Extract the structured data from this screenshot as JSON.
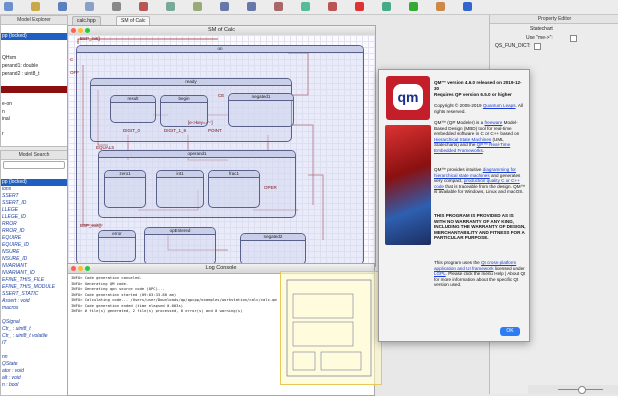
{
  "toolbar": {
    "icons": [
      "new-icon",
      "open-icon",
      "save-icon",
      "save-all-icon",
      "print-icon",
      "cut-icon",
      "copy-icon",
      "paste-icon",
      "undo-icon",
      "redo-icon",
      "find-icon",
      "zoom-in-icon",
      "zoom-out-icon",
      "code-gen-icon",
      "build-icon",
      "run-icon",
      "debug-icon",
      "help-icon"
    ]
  },
  "model_explorer": {
    "title": "Model Explorer",
    "rows": [
      {
        "text": "",
        "style": ""
      },
      {
        "text": "pp {locked}",
        "style": "sel"
      },
      {
        "text": "",
        "style": ""
      },
      {
        "text": "",
        "style": ""
      },
      {
        "text": "QHsm",
        "style": ""
      },
      {
        "text": "perand1: double",
        "style": ""
      },
      {
        "text": "perand2 : uint8_t",
        "style": ""
      },
      {
        "text": "",
        "style": ""
      },
      {
        "text": "",
        "style": "dark"
      },
      {
        "text": "",
        "style": ""
      },
      {
        "text": "e-on",
        "style": ""
      },
      {
        "text": "n",
        "style": ""
      },
      {
        "text": "inal",
        "style": ""
      },
      {
        "text": "",
        "style": ""
      },
      {
        "text": "r",
        "style": ""
      }
    ]
  },
  "model_search": {
    "title": "Model Search",
    "rows": [
      {
        "text": "pp {locked}",
        "style": "sel"
      },
      {
        "text": "ions",
        "style": ""
      },
      {
        "text": "SSERT",
        "style": ""
      },
      {
        "text": "SSERT_ID",
        "style": ""
      },
      {
        "text": "LLEGE",
        "style": ""
      },
      {
        "text": "LLEGE_ID",
        "style": ""
      },
      {
        "text": "RROR",
        "style": ""
      },
      {
        "text": "RROR_ID",
        "style": ""
      },
      {
        "text": "EQUIRE",
        "style": ""
      },
      {
        "text": "EQUIRE_ID",
        "style": ""
      },
      {
        "text": "NSURE",
        "style": ""
      },
      {
        "text": "NSURE_ID",
        "style": ""
      },
      {
        "text": "NVARIANT",
        "style": ""
      },
      {
        "text": "NVARIANT_ID",
        "style": ""
      },
      {
        "text": "EFINE_THIS_FILE",
        "style": ""
      },
      {
        "text": "EFINE_THIS_MODULE",
        "style": ""
      },
      {
        "text": "SSERT_STATIC",
        "style": ""
      },
      {
        "text": "Assert : void",
        "style": ""
      },
      {
        "text": "macros",
        "style": ""
      },
      {
        "text": "",
        "style": ""
      },
      {
        "text": "QSignal",
        "style": ""
      },
      {
        "text": "Ctr_ : uint8_t",
        "style": ""
      },
      {
        "text": "Ctr_ : uint8_t volatile",
        "style": ""
      },
      {
        "text": "IT",
        "style": ""
      },
      {
        "text": "",
        "style": ""
      },
      {
        "text": "nn",
        "style": ""
      },
      {
        "text": "QState",
        "style": ""
      },
      {
        "text": "ator : void",
        "style": ""
      },
      {
        "text": "alt : void",
        "style": ""
      },
      {
        "text": "n : bool",
        "style": ""
      }
    ]
  },
  "tabs": [
    {
      "label": "calc.hpp",
      "active": false
    },
    {
      "label": "SM of Calc",
      "active": true
    }
  ],
  "diagram": {
    "title": "SM of Calc",
    "states": {
      "on": "on",
      "ready": "ready",
      "result": "result",
      "begin": "begin",
      "negated1": "negated1",
      "operand1": "operand1",
      "zero1": "zero1",
      "int1": "int1",
      "frac1": "frac1",
      "error": "error",
      "opEntered": "opEntered",
      "negated2": "negated2"
    },
    "labels": {
      "off": "OFF",
      "c": "C",
      "equals": "EQUALS",
      "ce": "CE",
      "digit0": "DIGIT_0",
      "digit19": "DIGIT_1_9",
      "point": "POINT",
      "oper": "OPER",
      "bsp_init": "BSP_init()",
      "bsp_exit": "BSP_exit()",
      "me_oper": "[e->key=='-']"
    }
  },
  "console": {
    "title": "Log Console",
    "lines": [
      "INFO> Code generation canceled.",
      "INFO> Generating QM code.",
      "INFO> Generating qpn source code (QPC)...",
      "INFO> Code generation started (09:03:33.80 am)",
      "INFO> Calculating code... /Users/user/Downloads/qp/qpcpp/examples/workstation/calc/calc.qm",
      "INFO> Code generation ended (time elapsed 0.003s)",
      "INFO> # file(s) generated, 2 file(s) processed, 0 error(s) and 0 warning(s)"
    ]
  },
  "about": {
    "version": "QM™ version 4.6.0 released on 2019-12-30",
    "requires": "Requires QP version 6.5.0 or higher",
    "copyright_prefix": "Copyright © 2005-2019 ",
    "copyright_link": "Quantum Leaps",
    "copyright_suffix": ". All rights reserved.",
    "p1_a": "QM™ (QP Modeler) is a ",
    "p1_link1": "freeware",
    "p1_b": " Model-Based Design (MBD) tool for real-time embedded software in C or C++ based on ",
    "p1_link2": "Hierarchical State Machines",
    "p1_c": " (UML Statecharts) and the ",
    "p1_link3": "QP™ Real-Time Embedded Frameworks",
    "p1_d": ".",
    "p2_a": "QM™ provides intuitive ",
    "p2_link1": "diagramming for hierarchical state machines",
    "p2_b": " and generates very compact, ",
    "p2_link2": "production quality C or C++ code",
    "p2_c": " that is traceable from the design. QM™ is available for Windows, Linux and macOS.",
    "disclaimer": "THIS PROGRAM IS PROVIDED AS IS WITH NO WARRANTY OF ANY KIND, INCLUDING THE WARRANTY OF DESIGN, MERCHANTABILITY AND FITNESS FOR A PARTICULAR PURPOSE.",
    "p3_a": "This program uses the ",
    "p3_link1": "Qt cross-platform application and UI framework",
    "p3_b": " licensed under ",
    "p3_link2": "LGPL",
    "p3_c": ". Please click the menu Help | About Qt for more information about the specific Qt version used.",
    "ok_label": "OK",
    "logo_text": "qm",
    "accent": "#c41e2a",
    "link_color": "#1a3fd0"
  },
  "property_editor": {
    "title": "Property Editor",
    "type": "Statechart",
    "use_label": "Use \"me->\":",
    "fun_dict": "QS_FUN_DICT:"
  },
  "colors": {
    "state_border": "#59608a",
    "transition": "#9b1c1c",
    "selection": "#1f5fbf"
  }
}
